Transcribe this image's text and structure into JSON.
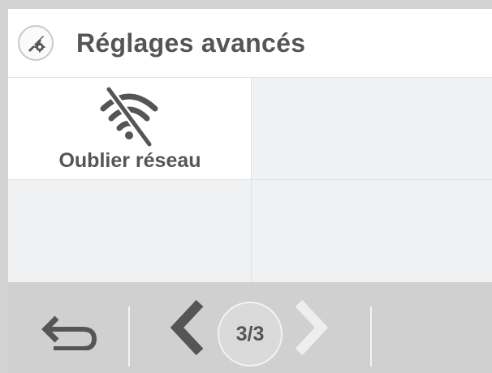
{
  "header": {
    "title": "Réglages avancés",
    "icon": "advanced-settings-tools-icon"
  },
  "grid": {
    "items": [
      {
        "label": "Oublier réseau",
        "icon": "wifi-off-icon"
      }
    ]
  },
  "footer": {
    "back_icon": "back-arrow-icon",
    "prev_icon": "chevron-left-icon",
    "next_icon": "chevron-right-icon",
    "page_indicator": "3/3",
    "current_page": 3,
    "total_pages": 3
  },
  "colors": {
    "text": "#555555",
    "footer_bg": "#d0d0d0",
    "grid_bg": "#f0f1f3",
    "disabled": "#f0f0f0"
  }
}
